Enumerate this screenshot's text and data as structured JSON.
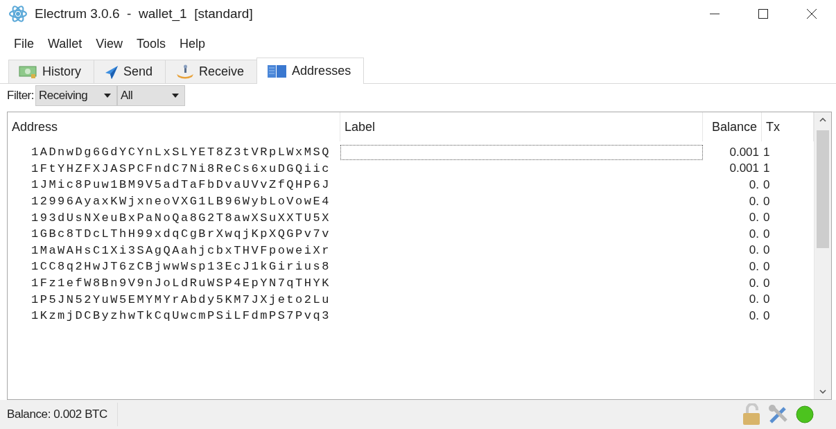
{
  "window": {
    "title": "Electrum 3.0.6  -  wallet_1  [standard]"
  },
  "menu": [
    "File",
    "Wallet",
    "View",
    "Tools",
    "Help"
  ],
  "tabs": [
    {
      "label": "History",
      "selected": false
    },
    {
      "label": "Send",
      "selected": false
    },
    {
      "label": "Receive",
      "selected": false
    },
    {
      "label": "Addresses",
      "selected": true
    }
  ],
  "filter": {
    "label": "Filter:",
    "type": "Receiving",
    "status": "All"
  },
  "table": {
    "columns": [
      "Address",
      "Label",
      "Balance",
      "Tx"
    ],
    "rows": [
      {
        "address": "1ADnwDg6GdYCYnLxSLYET8Z3tVRpLWxMSQ",
        "balance": "0.001",
        "tx": "1",
        "focused": true
      },
      {
        "address": "1FtYHZFXJASPCFndC7Ni8ReCs6xuDGQiic",
        "balance": "0.001",
        "tx": "1",
        "focused": false
      },
      {
        "address": "1JMic8Puw1BM9V5adTaFbDvaUVvZfQHP6J",
        "balance": "0.",
        "tx": "0",
        "focused": false
      },
      {
        "address": "12996AyaxKWjxneoVXG1LB96WybLoVowE4",
        "balance": "0.",
        "tx": "0",
        "focused": false
      },
      {
        "address": "193dUsNXeuBxPaNoQa8G2T8awXSuXXTU5X",
        "balance": "0.",
        "tx": "0",
        "focused": false
      },
      {
        "address": "1GBc8TDcLThH99xdqCgBrXwqjKpXQGPv7v",
        "balance": "0.",
        "tx": "0",
        "focused": false
      },
      {
        "address": "1MaWAHsC1Xi3SAgQAahjcbxTHVFpoweiXr",
        "balance": "0.",
        "tx": "0",
        "focused": false
      },
      {
        "address": "1CC8q2HwJT6zCBjwwWsp13EcJ1kGirius8",
        "balance": "0.",
        "tx": "0",
        "focused": false
      },
      {
        "address": "1Fz1efW8Bn9V9nJoLdRuWSP4EpYN7qTHYK",
        "balance": "0.",
        "tx": "0",
        "focused": false
      },
      {
        "address": "1P5JN52YuW5EMYMYrAbdy5KM7JXjeto2Lu",
        "balance": "0.",
        "tx": "0",
        "focused": false
      },
      {
        "address": "1KzmjDCByzhwTkCqUwcmPSiLFdmPS7Pvq3",
        "balance": "0.",
        "tx": "0",
        "focused": false
      }
    ]
  },
  "status_bar": {
    "balance": "Balance: 0.002 BTC"
  }
}
